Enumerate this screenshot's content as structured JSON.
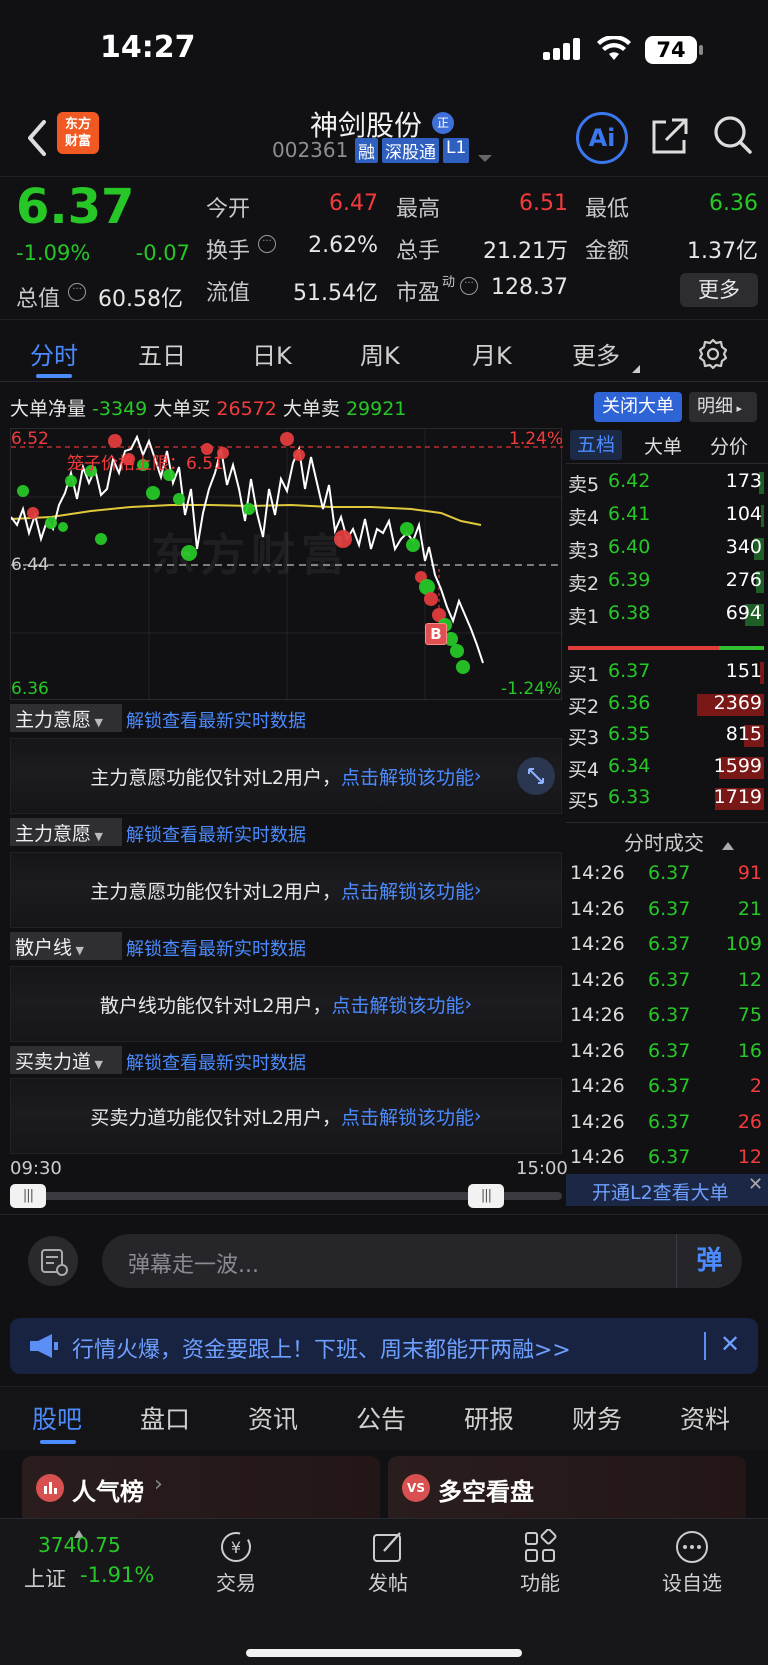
{
  "status": {
    "time": "14:27",
    "battery": "74"
  },
  "header": {
    "logo_line1": "东方",
    "logo_line2": "财富",
    "stock_name": "神剑股份",
    "badge_zheng": "正",
    "code": "002361",
    "tags": [
      "融",
      "深股通",
      "L1"
    ],
    "ai_label": "Ai"
  },
  "quote": {
    "price": "6.37",
    "change_pct": "-1.09%",
    "change": "-0.07",
    "open_label": "今开",
    "open": "6.47",
    "high_label": "最高",
    "high": "6.51",
    "low_label": "最低",
    "low": "6.36",
    "turnover_label": "换手",
    "turnover": "2.62%",
    "volume_label": "总手",
    "volume": "21.21万",
    "amount_label": "金额",
    "amount": "1.37亿",
    "mktcap_label": "总值",
    "mktcap": "60.58亿",
    "float_label": "流值",
    "float": "51.54亿",
    "pe_label": "市盈",
    "pe_sup": "动",
    "pe": "128.37",
    "more": "更多"
  },
  "tabs": [
    "分时",
    "五日",
    "日K",
    "周K",
    "月K",
    "更多"
  ],
  "bigorder": {
    "net_label": "大单净量",
    "net": "-3349",
    "buy_label": "大单买",
    "buy": "26572",
    "sell_label": "大单卖",
    "sell": "29921",
    "close_btn": "关闭大单",
    "detail_btn": "明细"
  },
  "chart": {
    "y_top": "6.52",
    "y_top_pct": "1.24%",
    "y_mid": "6.44",
    "y_bottom": "6.36",
    "y_bottom_pct": "-1.24%",
    "cage_label": "笼子价格上限：6.51",
    "watermark": "东方财富",
    "b_marker": "B",
    "time_start": "09:30",
    "time_end": "15:00"
  },
  "sections": [
    {
      "select": "主力意愿",
      "link": "解锁查看最新实时数据",
      "msg": "主力意愿功能仅针对L2用户，",
      "cta": "点击解锁该功能"
    },
    {
      "select": "主力意愿",
      "link": "解锁查看最新实时数据",
      "msg": "主力意愿功能仅针对L2用户，",
      "cta": "点击解锁该功能"
    },
    {
      "select": "散户线",
      "link": "解锁查看最新实时数据",
      "msg": "散户线功能仅针对L2用户，",
      "cta": "点击解锁该功能"
    },
    {
      "select": "买卖力道",
      "link": "解锁查看最新实时数据",
      "msg": "买卖力道功能仅针对L2用户，",
      "cta": "点击解锁该功能"
    }
  ],
  "orderbook": {
    "tabs": [
      "五档",
      "大单",
      "分价"
    ],
    "asks": [
      {
        "label": "卖5",
        "price": "6.42",
        "vol": "173",
        "bar": 0.03
      },
      {
        "label": "卖4",
        "price": "6.41",
        "vol": "104",
        "bar": 0.02
      },
      {
        "label": "卖3",
        "price": "6.40",
        "vol": "340",
        "bar": 0.06
      },
      {
        "label": "卖2",
        "price": "6.39",
        "vol": "276",
        "bar": 0.05
      },
      {
        "label": "卖1",
        "price": "6.38",
        "vol": "694",
        "bar": 0.12
      }
    ],
    "bids": [
      {
        "label": "买1",
        "price": "6.37",
        "vol": "151",
        "bar": 0.03
      },
      {
        "label": "买2",
        "price": "6.36",
        "vol": "2369",
        "bar": 0.48
      },
      {
        "label": "买3",
        "price": "6.35",
        "vol": "815",
        "bar": 0.14
      },
      {
        "label": "买4",
        "price": "6.34",
        "vol": "1599",
        "bar": 0.32
      },
      {
        "label": "买5",
        "price": "6.33",
        "vol": "1719",
        "bar": 0.35
      }
    ],
    "ticks_title": "分时成交",
    "ticks": [
      {
        "time": "14:26",
        "price": "6.37",
        "vol": "91",
        "dir": "up"
      },
      {
        "time": "14:26",
        "price": "6.37",
        "vol": "21",
        "dir": "down"
      },
      {
        "time": "14:26",
        "price": "6.37",
        "vol": "109",
        "dir": "down"
      },
      {
        "time": "14:26",
        "price": "6.37",
        "vol": "12",
        "dir": "down"
      },
      {
        "time": "14:26",
        "price": "6.37",
        "vol": "75",
        "dir": "down"
      },
      {
        "time": "14:26",
        "price": "6.37",
        "vol": "16",
        "dir": "down"
      },
      {
        "time": "14:26",
        "price": "6.37",
        "vol": "2",
        "dir": "up"
      },
      {
        "time": "14:26",
        "price": "6.37",
        "vol": "26",
        "dir": "up"
      },
      {
        "time": "14:26",
        "price": "6.37",
        "vol": "12",
        "dir": "up"
      }
    ],
    "l2_banner": "开通L2查看大单"
  },
  "danmu": {
    "placeholder": "弹幕走一波...",
    "send": "弹"
  },
  "promo": {
    "text": "行情火爆，资金要跟上！下班、周末都能开两融>>"
  },
  "f10_tabs": [
    "股吧",
    "盘口",
    "资讯",
    "公告",
    "研报",
    "财务",
    "资料"
  ],
  "cards": [
    {
      "title": "人气榜"
    },
    {
      "title": "多空看盘"
    }
  ],
  "bottom_nav": {
    "index_value": "3740.75",
    "index_name": "上证",
    "index_change": "-1.91%",
    "items": [
      "交易",
      "发帖",
      "功能",
      "设自选"
    ]
  },
  "colors": {
    "up": "#f23c3c",
    "down": "#26c726",
    "accent": "#4b8bff",
    "avg_line": "#e0c93a"
  }
}
